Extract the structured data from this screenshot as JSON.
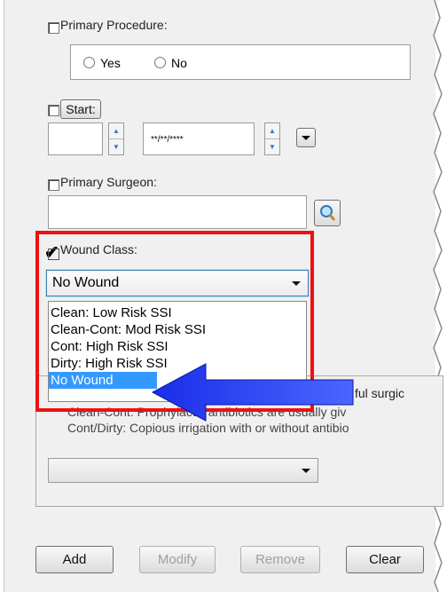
{
  "procedure": {
    "label": "Primary Procedure:",
    "yes_label": "Yes",
    "no_label": "No"
  },
  "start": {
    "label": "Start:",
    "date_placeholder": "**/**/****"
  },
  "surgeon": {
    "label": "Primary Surgeon:"
  },
  "wound": {
    "label": "Wound Class:",
    "selected": "No Wound",
    "options": [
      "Clean: Low Risk SSI",
      "Clean-Cont: Mod Risk SSI",
      "Cont: High Risk SSI",
      "Dirty: High Risk SSI",
      "No Wound"
    ]
  },
  "info": {
    "line1_end": "ful surgic",
    "line2": "Clean-Cont: Prophylactic antibiotics are usually giv",
    "line3": "Cont/Dirty: Copious irrigation with or without antibio"
  },
  "buttons": {
    "add": "Add",
    "modify": "Modify",
    "remove": "Remove",
    "clear": "Clear"
  },
  "colors": {
    "highlight_box": "#ee1111",
    "arrow": "#1a2ee8",
    "selection": "#3399ff"
  }
}
